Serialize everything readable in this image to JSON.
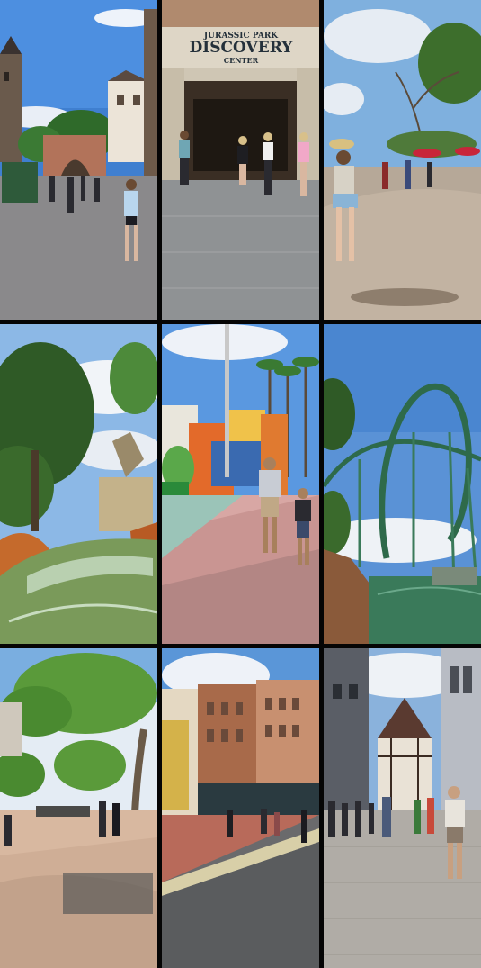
{
  "collage": {
    "tiles": [
      {
        "scene": "hogsmeade-village-street",
        "icon": "photo-icon"
      },
      {
        "scene": "discovery-center-entrance",
        "sign_small": "JURASSIC PARK",
        "sign_large": "DISCOVERY",
        "sign_sub": "CENTER"
      },
      {
        "scene": "walkway-with-palms",
        "icon": "photo-icon"
      },
      {
        "scene": "river-rapids-waterfall",
        "icon": "photo-icon"
      },
      {
        "scene": "toon-lagoon-street",
        "icon": "photo-icon"
      },
      {
        "scene": "green-roller-coaster-loop",
        "icon": "photo-icon"
      },
      {
        "scene": "tree-lined-plaza",
        "icon": "photo-icon"
      },
      {
        "scene": "themed-city-street",
        "icon": "photo-icon"
      },
      {
        "scene": "hogsmeade-tudor-street",
        "icon": "photo-icon"
      }
    ]
  }
}
